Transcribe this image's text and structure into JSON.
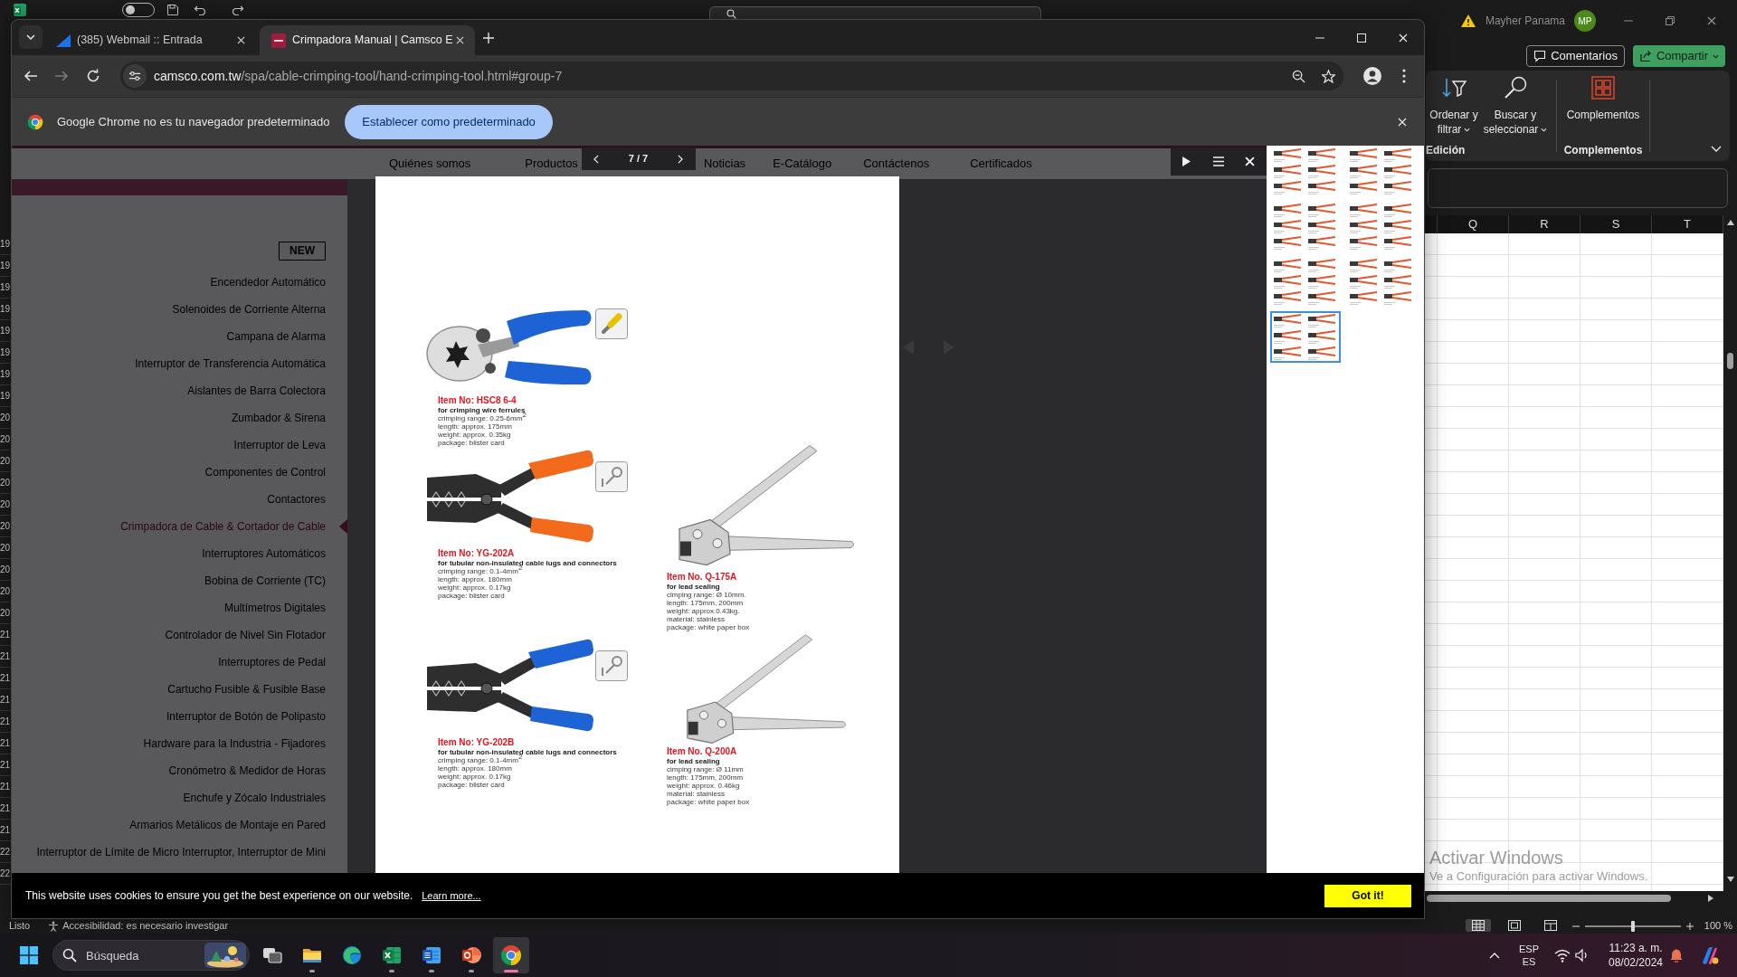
{
  "excel": {
    "autosave": {
      "on": false
    },
    "account": {
      "name": "Mayher Panama",
      "initials": "MP"
    },
    "actions": [
      {
        "kind": "comments",
        "label": "Comentarios"
      },
      {
        "kind": "share",
        "label": "Compartir"
      }
    ],
    "ribbon_groups": [
      {
        "label": "Edición",
        "commands": [
          {
            "kind": "sort_filter",
            "lines": [
              "Ordenar y",
              "filtrar"
            ],
            "dropdown": true
          },
          {
            "kind": "find",
            "lines": [
              "Buscar y",
              "seleccionar"
            ],
            "dropdown": true
          }
        ]
      },
      {
        "label": "Complementos",
        "commands": [
          {
            "kind": "addins",
            "lines": [
              "Complementos"
            ],
            "dropdown": false
          }
        ]
      }
    ],
    "columns": [
      "Q",
      "R",
      "S",
      "T"
    ],
    "row_numbers": [
      "19",
      "19",
      "19",
      "19",
      "19",
      "19",
      "19",
      "19",
      "20",
      "20",
      "20",
      "20",
      "20",
      "20",
      "20",
      "20",
      "20",
      "20",
      "21",
      "21",
      "21",
      "21",
      "21",
      "21",
      "21",
      "21",
      "21",
      "21",
      "22",
      "22"
    ],
    "status_bar": {
      "status": "Listo",
      "accessibility": "Accesibilidad: es necesario investigar",
      "views": [
        {
          "kind": "normal",
          "selected": true
        },
        {
          "kind": "page_layout",
          "selected": false
        },
        {
          "kind": "page_break",
          "selected": false
        }
      ],
      "zoom_slider": {
        "level": 0.5
      },
      "zoom": "100 %"
    }
  },
  "activation_notice": {
    "title": "Activar Windows",
    "message": "Ve a Configuración para activar Windows."
  },
  "browser": {
    "tabs": [
      {
        "kind": "webmail",
        "title": "(385) Webmail :: Entrada",
        "selected": false
      },
      {
        "kind": "camsco",
        "title": "Crimpadora Manual | Camsco E",
        "selected": true
      }
    ],
    "address": {
      "host": "camsco.com.tw",
      "path": "/spa/cable-crimping-tool/hand-crimping-tool.html#group-7"
    },
    "infobar": {
      "message": "Google Chrome no es tu navegador predeterminado",
      "button": "Establecer como predeterminado"
    },
    "site": {
      "nav": [
        "Quiénes somos",
        "Productos",
        "Noticias",
        "E-Catálogo",
        "Contáctenos",
        "Certificados"
      ],
      "sidebar": {
        "badge": "NEW",
        "items": [
          {
            "label": "Encendedor Automático",
            "selected": false
          },
          {
            "label": "Solenoides de Corriente Alterna",
            "selected": false
          },
          {
            "label": "Campana de Alarma",
            "selected": false
          },
          {
            "label": "Interruptor de Transferencia Automática",
            "selected": false
          },
          {
            "label": "Aislantes de Barra Colectora",
            "selected": false
          },
          {
            "label": "Zumbador & Sirena",
            "selected": false
          },
          {
            "label": "Interruptor de Leva",
            "selected": false
          },
          {
            "label": "Componentes de Control",
            "selected": false
          },
          {
            "label": "Contactores",
            "selected": false
          },
          {
            "label": "Crimpadora de Cable & Cortador de Cable",
            "selected": true
          },
          {
            "label": "Interruptores Automáticos",
            "selected": false
          },
          {
            "label": "Bobina de Corriente (TC)",
            "selected": false
          },
          {
            "label": "Multímetros Digitales",
            "selected": false
          },
          {
            "label": "Controlador de Nivel Sin Flotador",
            "selected": false
          },
          {
            "label": "Interruptores de Pedal",
            "selected": false
          },
          {
            "label": "Cartucho Fusible & Fusible Base",
            "selected": false
          },
          {
            "label": "Interruptor de Botón de Polipasto",
            "selected": false
          },
          {
            "label": "Hardware para la Industria - Fijadores",
            "selected": false
          },
          {
            "label": "Cronómetro & Medidor de Horas",
            "selected": false
          },
          {
            "label": "Enchufe y Zócalo Industriales",
            "selected": false
          },
          {
            "label": "Armarios Metálicos de Montaje en Pared",
            "selected": false
          },
          {
            "label": "Interruptor de Límite de Micro Interruptor, Interruptor de Mini",
            "selected": false
          }
        ]
      }
    },
    "viewer": {
      "counter": "7 / 7",
      "thumbnails": [
        {
          "selected": false
        },
        {
          "selected": false
        },
        {
          "selected": false
        },
        {
          "selected": false
        },
        {
          "selected": false
        },
        {
          "selected": false
        },
        {
          "selected": true
        }
      ],
      "catalog_page": {
        "left_column": [
          {
            "kind": "ferrule_crimper",
            "color": "#1e63d6",
            "title": "Item No: HSC8 6-4",
            "use": "for crimping wire ferrules",
            "specs": [
              "crimping range: 0.25-6mm$^{2}$",
              "length: approx. 175mm",
              "weight: approx. 0.35kg",
              "package: blister card"
            ]
          },
          {
            "kind": "terminal_crimper",
            "color": "#f26a1b",
            "title": "Item No: YG-202A",
            "use": "for tubular non-insulated cable lugs and connectors",
            "specs": [
              "crimping range: 0.1-4mm$^{2}$",
              "length: approx. 180mm",
              "weight: approx. 0.17kg",
              "package: blister card"
            ]
          },
          {
            "kind": "terminal_crimper",
            "color": "#1e63d6",
            "title": "Item No: YG-202B",
            "use": "for tubular non-insulated cable lugs and connectors",
            "specs": [
              "crimping range: 0.1-4mm$^{2}$",
              "length: approx. 180mm",
              "weight: approx. 0.17kg",
              "package: blister card"
            ]
          }
        ],
        "right_column": [
          {
            "kind": "lead_sealer",
            "title": "Item No. Q-175A",
            "use": "for lead sealing",
            "specs": [
              "cimping range: Ø 10mm.",
              "length: 175mm, 200mm",
              "weight: approx.0.43kg.",
              "material: stainless",
              "package: white paper box"
            ]
          },
          {
            "kind": "lead_sealer",
            "title": "Item No. Q-200A",
            "use": "for lead sealing",
            "specs": [
              "cimping range: Ø 11mm",
              "length: 175mm, 200mm",
              "weight: approx. 0.46kg",
              "material: stainless",
              "package: white paper box"
            ]
          }
        ]
      }
    },
    "cookie_banner": {
      "message": "This website uses cookies to ensure you get the best experience on our website.",
      "link": "Learn more...",
      "button": "Got it!"
    }
  },
  "taskbar": {
    "search_placeholder": "Búsqueda",
    "apps": [
      {
        "kind": "task_view",
        "running": false,
        "selected": false
      },
      {
        "kind": "file_explorer",
        "running": true,
        "selected": false
      },
      {
        "kind": "edge",
        "running": false,
        "selected": false
      },
      {
        "kind": "excel",
        "running": true,
        "selected": false
      },
      {
        "kind": "word",
        "running": true,
        "selected": false
      },
      {
        "kind": "powerpoint",
        "running": true,
        "selected": false
      },
      {
        "kind": "chrome",
        "running": true,
        "selected": true
      }
    ],
    "tray": {
      "language": "ESP",
      "layout": "ES",
      "time": "11:23 a. m.",
      "date": "08/02/2024"
    }
  }
}
